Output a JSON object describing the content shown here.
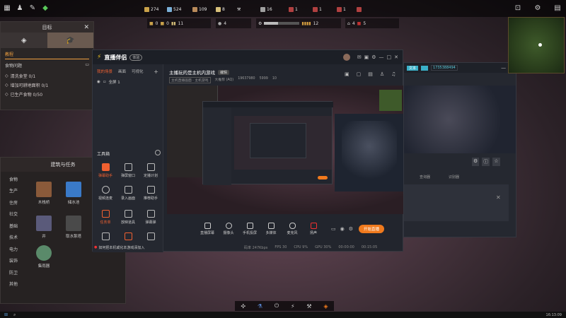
{
  "hud": {
    "resources": [
      {
        "value": "274",
        "color": "#c9a24a"
      },
      {
        "value": "524",
        "color": "#7ab0d8"
      },
      {
        "value": "109",
        "color": "#b98a5a"
      },
      {
        "value": "8",
        "color": "#d8c07a"
      },
      {
        "value": "16",
        "color": "#a0a0a0"
      },
      {
        "value": "1",
        "color": "#b04040"
      },
      {
        "value": "1",
        "color": "#b04040"
      },
      {
        "value": "1",
        "color": "#b04040"
      }
    ],
    "row2": [
      "0",
      "0",
      "11",
      "4",
      "12",
      "4",
      "5"
    ]
  },
  "goal_panel": {
    "title": "目标",
    "section": "教程",
    "subsection": "食物问题",
    "tasks": [
      "清洗食堂 0/1",
      "增加可耕地面积 0/1",
      "已生产食物 0/50"
    ]
  },
  "build_panel": {
    "title": "建筑与任务",
    "categories": [
      "食物",
      "生产",
      "住房",
      "社交",
      "基础",
      "技术",
      "电力",
      "装饰",
      "防卫",
      "其他"
    ],
    "items": [
      {
        "label": "木栈桥",
        "color": "#8a5a3a"
      },
      {
        "label": "储水池",
        "color": "#3a7ac8"
      },
      {
        "label": "井",
        "color": "#5a5a7a"
      },
      {
        "label": "取水泵塔",
        "color": "#4a4a4a"
      },
      {
        "label": "集雨器",
        "color": "#5a8a6a"
      }
    ]
  },
  "stream_app": {
    "name": "直播伴侣",
    "badge": "体验",
    "scene_tabs": [
      "我的场景",
      "画面",
      "可视化"
    ],
    "source_label": "全屏 1",
    "stream_title": "主播玩的是主机内游戏",
    "title_badge": "编辑",
    "subtitle": "主机直播画面 · 主机游戏",
    "viewer_info": "大推荐 (AQ)",
    "stats": [
      "19637980",
      "5999",
      "10"
    ],
    "toolbox_label": "工具箱",
    "tools": [
      "弹幕助手",
      "弹屏窗口",
      "定播计划",
      "视频连麦",
      "录入画面",
      "推荐助手",
      "任务单",
      "放映道具",
      "弹幕弹",
      "助手",
      "更多"
    ],
    "notice": "如何把本机或化本游戏添加入",
    "bottom_tools": [
      "直播屏幕",
      "摄像头",
      "手机投屏",
      "多媒体",
      "麦克风",
      "扬声"
    ],
    "start_button": "开始直播",
    "status_items": [
      "码率 247Kbps",
      "FPS 30",
      "CPU 9%",
      "GPU 30%",
      "00:00:00",
      "00:15:05"
    ]
  },
  "console": {
    "tab": "文本",
    "dropdown": "1735388494",
    "columns": [
      "查询器",
      "识别器"
    ]
  },
  "bottom_hud_icons": [
    "wind-icon",
    "flask-icon",
    "power-icon",
    "bolt-icon",
    "hammer-icon",
    "diamond-icon"
  ],
  "clock": "16:13:09"
}
